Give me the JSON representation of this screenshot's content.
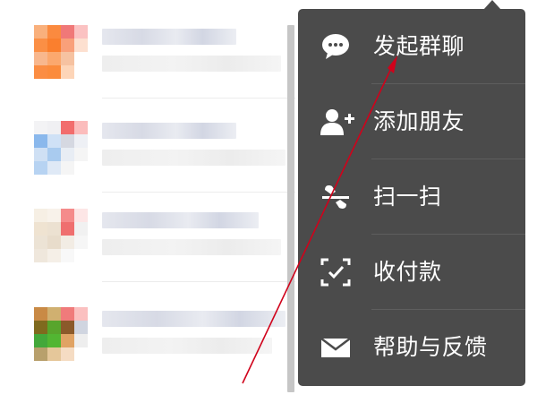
{
  "menu": {
    "items": [
      {
        "label": "发起群聊",
        "icon": "chat-bubble-icon"
      },
      {
        "label": "添加朋友",
        "icon": "add-user-icon"
      },
      {
        "label": "扫一扫",
        "icon": "scan-icon"
      },
      {
        "label": "收付款",
        "icon": "payment-icon"
      },
      {
        "label": "帮助与反馈",
        "icon": "mail-icon"
      }
    ]
  },
  "colors": {
    "menu_background": "#4b4b4b",
    "menu_text": "#ffffff",
    "annotation_arrow": "#d0021b"
  }
}
